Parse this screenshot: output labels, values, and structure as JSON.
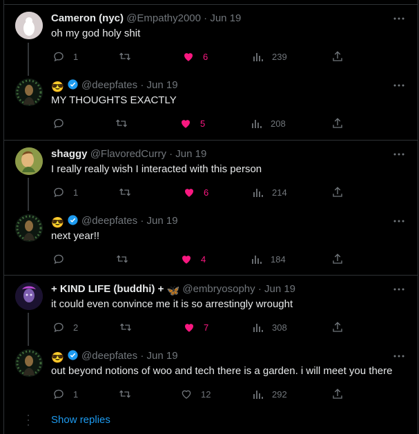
{
  "tweets": [
    {
      "name": "Cameron (nyc)",
      "handle": "@Empathy2000",
      "date": "Jun 19",
      "text": "oh my god holy shit",
      "replies": "1",
      "retweets": "",
      "likes": "6",
      "liked": true,
      "views": "239"
    },
    {
      "name": "😎",
      "verified": true,
      "handle": "@deepfates",
      "date": "Jun 19",
      "text": "MY THOUGHTS EXACTLY",
      "replies": "",
      "retweets": "",
      "likes": "5",
      "liked": true,
      "views": "208"
    },
    {
      "name": "shaggy",
      "handle": "@FlavoredCurry",
      "date": "Jun 19",
      "text": "I really really wish I interacted with this person",
      "replies": "1",
      "retweets": "",
      "likes": "6",
      "liked": true,
      "views": "214"
    },
    {
      "name": "😎",
      "verified": true,
      "handle": "@deepfates",
      "date": "Jun 19",
      "text": "next year!!",
      "replies": "",
      "retweets": "",
      "likes": "4",
      "liked": true,
      "views": "184"
    },
    {
      "name": "+ KIND LIFE (buddhi) +",
      "name_emoji": "🦋",
      "handle": "@embryosophy",
      "date": "Jun 19",
      "text": "it could even convince me it is so arrestingly wrought",
      "replies": "2",
      "retweets": "",
      "likes": "7",
      "liked": true,
      "views": "308"
    },
    {
      "name": "😎",
      "verified": true,
      "handle": "@deepfates",
      "date": "Jun 19",
      "text": "out beyond notions of woo and tech there is a garden. i will meet you there",
      "replies": "1",
      "retweets": "",
      "likes": "12",
      "liked": false,
      "views": "292"
    }
  ],
  "show_replies": "Show replies",
  "colors": {
    "like": "#f91880",
    "link": "#1d9bf0",
    "muted": "#71767b",
    "verified": "#1d9bf0"
  }
}
